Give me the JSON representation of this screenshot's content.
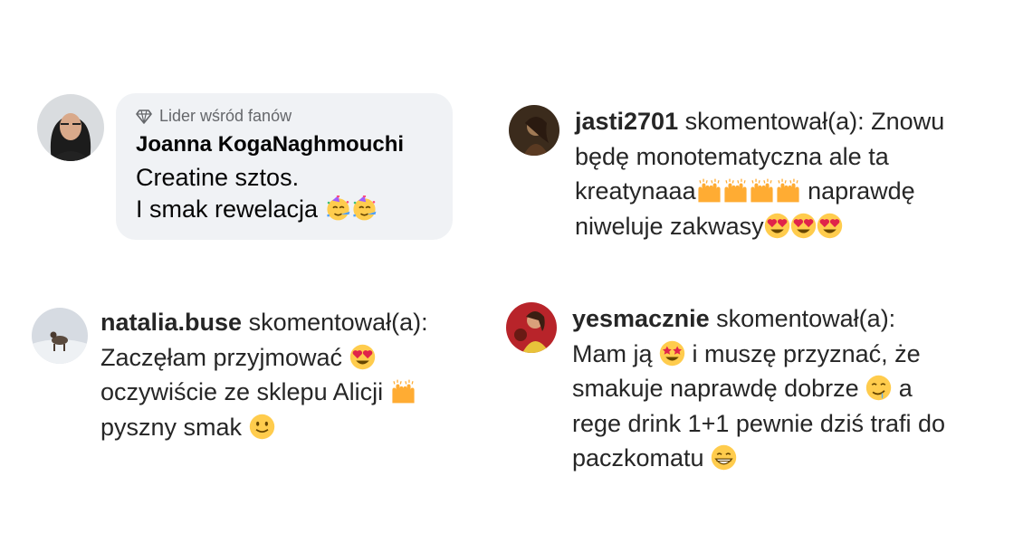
{
  "fb_comment": {
    "badge": "Lider wśród fanów",
    "author": "Joanna KogaNaghmouchi",
    "line1": "Creatine sztos.",
    "line2": "I smak rewelacja"
  },
  "ig_comments": [
    {
      "username": "jasti2701",
      "action": " skomentował(a):",
      "l1": " Znowu",
      "l2": "będę monotematyczna ale ta",
      "l3a": "kreatynaaa",
      "l3b": " naprawdę",
      "l4": "niweluje zakwasy"
    },
    {
      "username": "natalia.buse",
      "action": " skomentował(a):",
      "l2": "Zaczęłam przyjmować ",
      "l3": "oczywiście ze sklepu Alicji ",
      "l4": "pyszny smak "
    },
    {
      "username": "yesmacznie",
      "action": " skomentował(a):",
      "l2a": "Mam ją ",
      "l2b": " i muszę przyznać, że",
      "l3a": "smakuje naprawdę dobrze ",
      "l3b": " a",
      "l4": "rege drink 1+1 pewnie dziś trafi do",
      "l5": "paczkomatu "
    }
  ],
  "icons": {
    "badge": "diamond-icon",
    "party": "partying-face-emoji",
    "raised_hands": "raising-hands-emoji",
    "heart_eyes": "heart-eyes-emoji",
    "star_struck": "star-struck-emoji",
    "drooling": "drooling-face-emoji",
    "grinning": "grinning-face-emoji",
    "smiling": "slightly-smiling-face-emoji"
  },
  "colors": {
    "bubble_bg": "#f0f2f5",
    "badge_text": "#65676b",
    "text": "#050505"
  }
}
